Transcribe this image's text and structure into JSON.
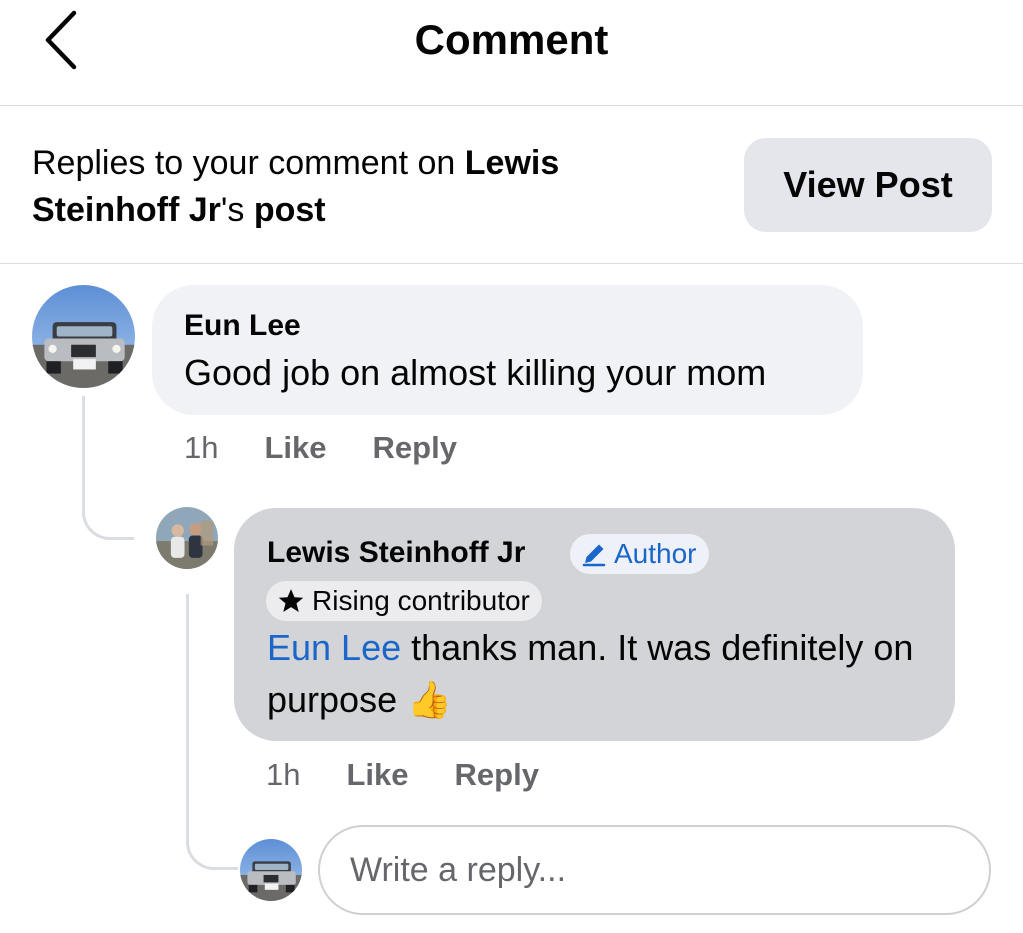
{
  "header": {
    "title": "Comment",
    "back_icon": "chevron-left-icon"
  },
  "context": {
    "prefix": "Replies to your comment on ",
    "post_owner": "Lewis Steinhoff Jr",
    "possessive": "'s ",
    "post_word": "post",
    "view_post_label": "View Post"
  },
  "comments": [
    {
      "author": "Eun Lee",
      "text": "Good job on almost killing your mom",
      "time": "1h",
      "like_label": "Like",
      "reply_label": "Reply"
    },
    {
      "author": "Lewis Steinhoff Jr",
      "author_badge": "Author",
      "contributor_badge": "Rising contributor",
      "mention": "Eun Lee",
      "text": " thanks man. It was definitely on purpose ",
      "emoji": "👍",
      "time": "1h",
      "like_label": "Like",
      "reply_label": "Reply"
    }
  ],
  "reply_box": {
    "placeholder": "Write a reply..."
  },
  "colors": {
    "link_blue": "#1b66c9",
    "bubble_gray": "#f0f2f5",
    "bubble_highlight": "#d2d4d8",
    "secondary_text": "#65676b",
    "button_bg": "#e4e6eb"
  }
}
